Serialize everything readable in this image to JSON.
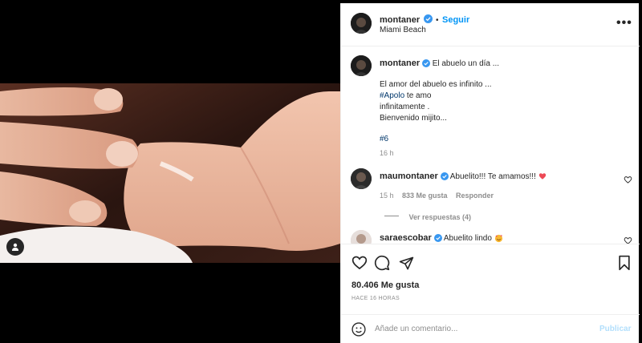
{
  "post": {
    "author": "montaner",
    "follow_label": "Seguir",
    "dot": "•",
    "location": "Miami Beach",
    "more_label": "•••"
  },
  "caption": {
    "author": "montaner",
    "title": "El abuelo un día ...",
    "line1": "El amor del abuelo es infinito ...",
    "hashtag1": "#Apolo",
    "line2_rest": " te amo",
    "line3": "infinitamente .",
    "line4": "Bienvenido mijito...",
    "hashtag2": "#6",
    "time": "16 h"
  },
  "comments": [
    {
      "author": "maumontaner",
      "text": "Abuelito!!! Te amamos!!!",
      "emoji": "❤️",
      "time": "15 h",
      "likes": "833 Me gusta",
      "reply_label": "Responder",
      "view_replies": "Ver respuestas (4)"
    },
    {
      "author": "saraescobar",
      "text": "Abuelito lindo",
      "emoji": "🥰"
    }
  ],
  "actions": {
    "likes_count": "80.406 Me gusta",
    "time_ago": "HACE 16 HORAS"
  },
  "add_comment": {
    "placeholder": "Añade un comentario...",
    "publish_label": "Publicar"
  },
  "colors": {
    "accent": "#0095f6",
    "verified": "#3897f0",
    "heart_red": "#ed4956",
    "hashtag": "#00376b"
  },
  "icons": {
    "verified": "verified-badge-icon",
    "like": "heart-icon",
    "comment": "comment-bubble-icon",
    "share": "paper-plane-icon",
    "save": "bookmark-icon",
    "emoji": "smiley-icon",
    "tag": "user-tag-icon"
  }
}
